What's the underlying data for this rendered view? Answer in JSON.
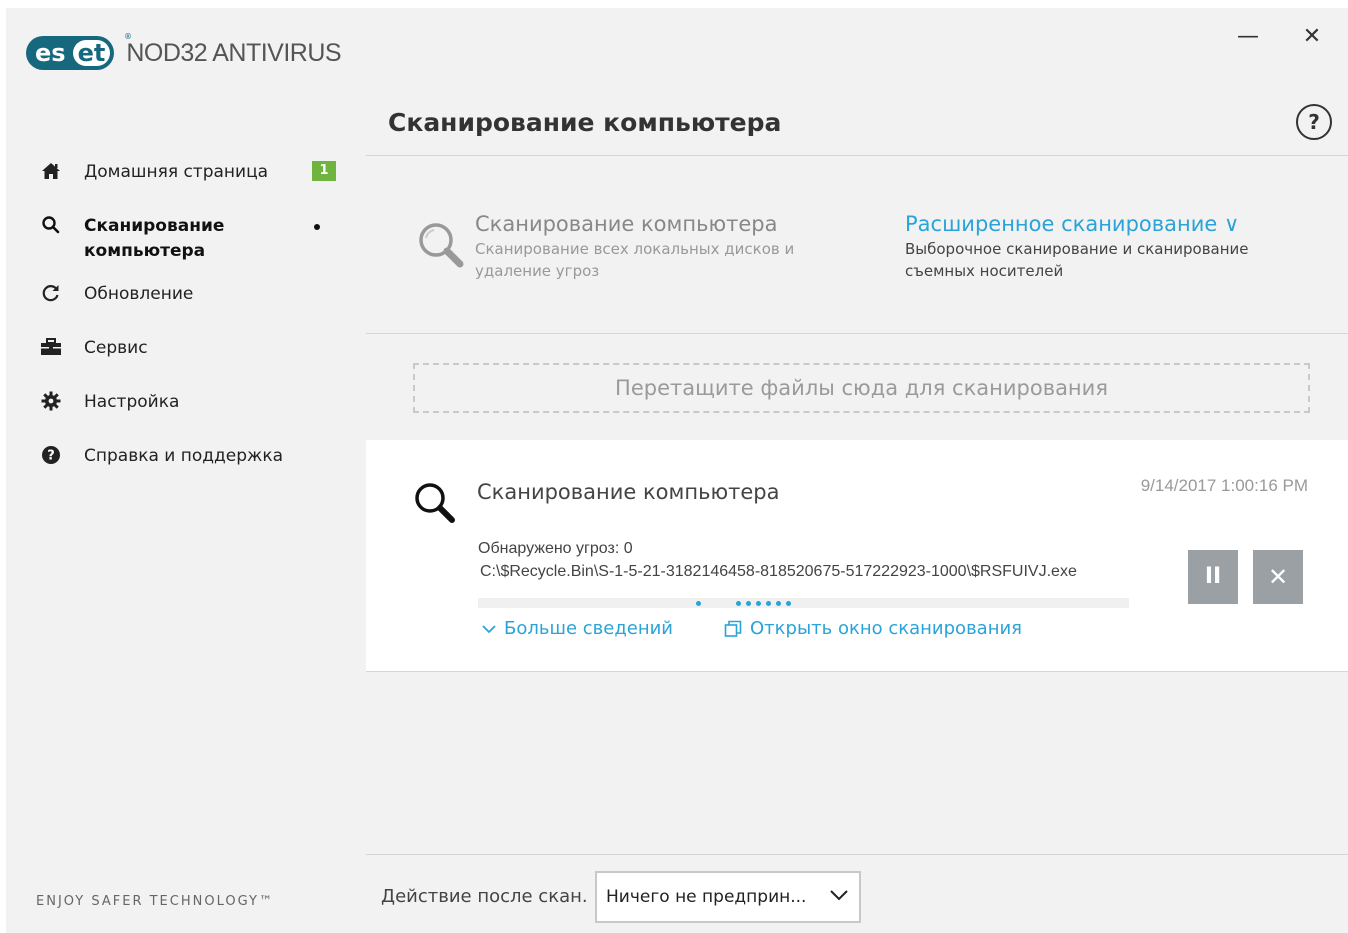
{
  "app": {
    "logo_left": "es",
    "logo_right": "et",
    "logo_reg": "®",
    "product_name": "NOD32 ANTIVIRUS",
    "minimize": "—",
    "close": "✕",
    "tagline": "ENJOY SAFER TECHNOLOGY™"
  },
  "sidebar": {
    "items": [
      {
        "label": "Домашняя страница",
        "icon": "home-icon",
        "badge": "1"
      },
      {
        "label": "Сканирование компьютера",
        "icon": "search-icon",
        "active": true
      },
      {
        "label": "Обновление",
        "icon": "refresh-icon"
      },
      {
        "label": "Сервис",
        "icon": "briefcase-icon"
      },
      {
        "label": "Настройка",
        "icon": "gear-icon"
      },
      {
        "label": "Справка и поддержка",
        "icon": "help-icon"
      }
    ]
  },
  "main": {
    "title": "Сканирование компьютера",
    "help": "?",
    "option_computer_scan": {
      "title": "Сканирование компьютера",
      "desc": "Сканирование всех локальных дисков и удаление угроз"
    },
    "option_advanced_scan": {
      "title": "Расширенное сканирование ∨",
      "desc": "Выборочное сканирование и сканирование съемных носителей"
    },
    "dropzone": "Перетащите файлы сюда для сканирования",
    "scan_card": {
      "title": "Сканирование компьютера",
      "timestamp": "9/14/2017 1:00:16 PM",
      "threats": "Обнаружено угроз: 0",
      "path": "C:\\$Recycle.Bin\\S-1-5-21-3182146458-818520675-517222923-1000\\$RSFUIVJ.exe",
      "pause": "II",
      "stop": "✕",
      "more_details": "Больше сведений",
      "open_scan_window": "Открыть окно сканирования"
    },
    "after_scan_label": "Действие после скан.",
    "after_scan_value": "Ничего не предприн..."
  },
  "colors": {
    "accent": "#2aa3d8",
    "brand": "#16687f",
    "badge": "#6fb43f",
    "button": "#9aa0a4"
  }
}
